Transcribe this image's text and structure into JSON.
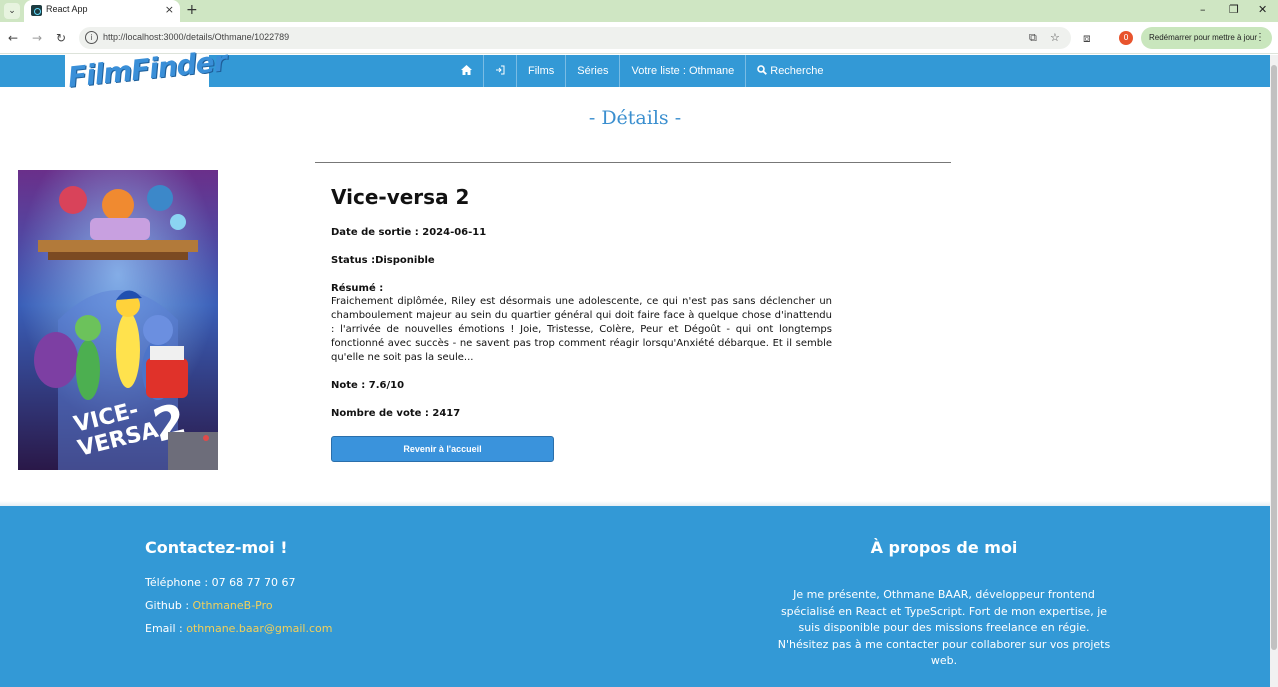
{
  "browser": {
    "tab_title": "React App",
    "tab_close": "×",
    "new_tab": "+",
    "url": "http://localhost:3000/details/Othmane/1022789",
    "profile_badge": "0",
    "update_label": "Redémarrer pour mettre à jour",
    "icons": [
      "tab-menu-icon",
      "favicon-react-icon",
      "back-icon",
      "forward-icon",
      "reload-icon",
      "site-info-icon",
      "install-icon",
      "bookmark-star-icon",
      "extensions-icon",
      "menu-dots-icon"
    ]
  },
  "navbar": {
    "logo": "FilmFinder",
    "items": [
      {
        "label": "",
        "icon": "home-icon"
      },
      {
        "label": "",
        "icon": "logout-icon"
      },
      {
        "label": "Films"
      },
      {
        "label": "Séries"
      },
      {
        "label": "Votre liste : Othmane"
      },
      {
        "label": "Recherche",
        "icon": "search-icon"
      }
    ],
    "color": "#3399d6"
  },
  "page": {
    "heading": "- Détails -"
  },
  "movie": {
    "title": "Vice-versa 2",
    "release_label": "Date de sortie : ",
    "release_date": "2024-06-11",
    "status_label": "Status :",
    "status": "Disponible",
    "resume_label": "Résumé :",
    "resume": "Fraichement diplômée, Riley est désormais une adolescente, ce qui n'est pas sans déclencher un chamboulement majeur au sein du quartier général qui doit faire face à quelque chose d'inattendu : l'arrivée de nouvelles émotions ! Joie, Tristesse, Colère, Peur et Dégoût - qui ont longtemps fonctionné avec succès - ne savent pas trop comment réagir lorsqu'Anxiété débarque. Et il semble qu'elle ne soit pas la seule...",
    "rating_label": "Note : ",
    "rating": "7.6/10",
    "votes_label": "Nombre de vote : ",
    "votes": "2417",
    "back_button": "Revenir à l'accueil",
    "poster_text_line1": "VICE-",
    "poster_text_line2": "VERSA",
    "poster_text_number": "2"
  },
  "footer": {
    "contact_title": "Contactez-moi !",
    "phone_label": "Téléphone : ",
    "phone": "07 68 77 70 67",
    "github_label": "Github : ",
    "github": "OthmaneB-Pro",
    "email_label": "Email : ",
    "email": "othmane.baar@gmail.com",
    "about_title": "À propos de moi",
    "about_text": "Je me présente, Othmane BAAR, développeur frontend spécialisé en React et TypeScript. Fort de mon expertise, je suis disponible pour des missions freelance en régie. N'hésitez pas à me contacter pour collaborer sur vos projets web.",
    "highlight_color": "#f3d05a"
  }
}
